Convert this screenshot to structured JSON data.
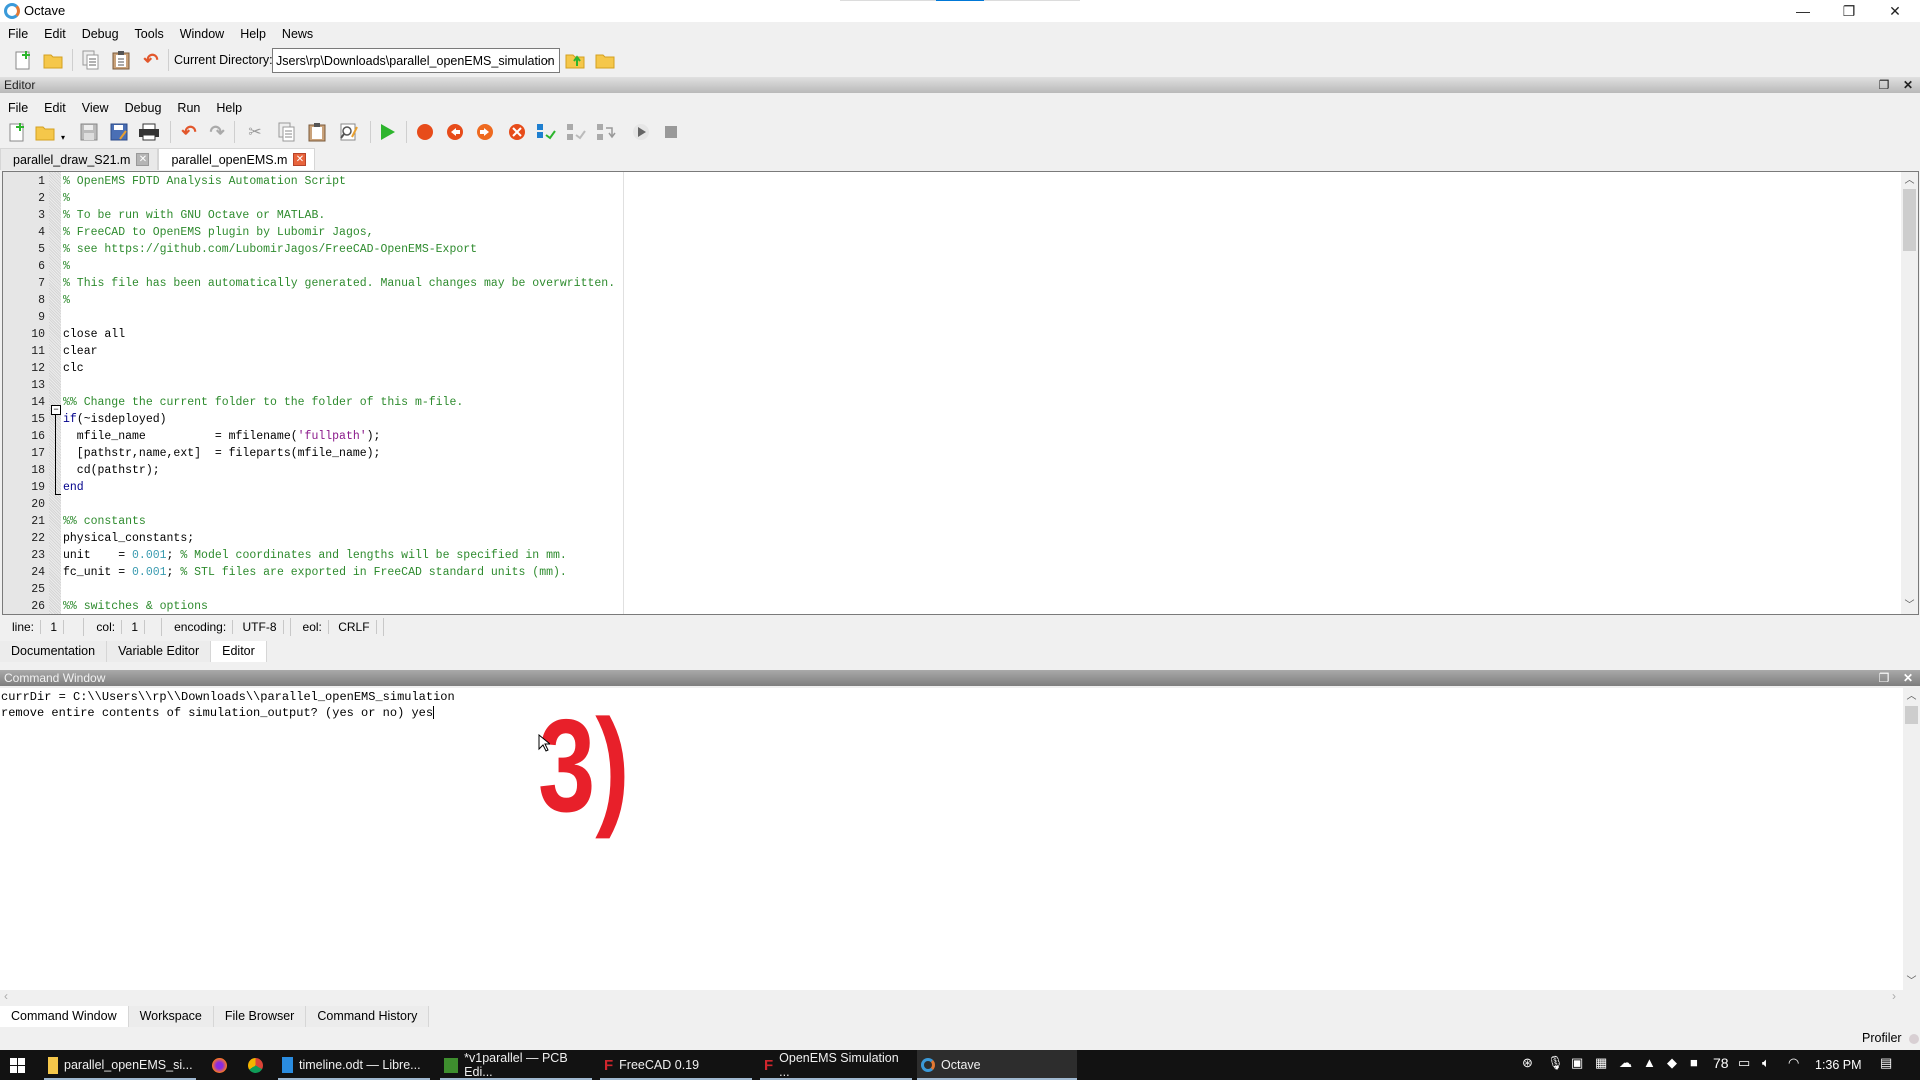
{
  "window": {
    "title": "Octave",
    "controls": {
      "minimize": "—",
      "restore": "❐",
      "close": "✕"
    }
  },
  "main_menu": [
    "File",
    "Edit",
    "Debug",
    "Tools",
    "Window",
    "Help",
    "News"
  ],
  "main_toolbar": {
    "icons": [
      "new-script-icon",
      "open-folder-icon",
      "copy-icon",
      "paste-icon",
      "undo-icon"
    ],
    "current_directory_label": "Current Directory:",
    "current_directory_value": "Jsers\\rp\\Downloads\\parallel_openEMS_simulation",
    "dir_icons": [
      "parent-directory-icon",
      "browse-folder-icon"
    ]
  },
  "editor": {
    "dock_title": "Editor",
    "menu": [
      "File",
      "Edit",
      "View",
      "Debug",
      "Run",
      "Help"
    ],
    "toolbar_icons": [
      "new-file-icon",
      "open-file-icon",
      "save-icon",
      "save-as-icon",
      "print-icon",
      "undo-icon",
      "redo-icon",
      "cut-icon",
      "copy-icon",
      "paste-icon",
      "find-replace-icon",
      "run-icon",
      "toggle-breakpoint-icon",
      "previous-breakpoint-icon",
      "next-breakpoint-icon",
      "remove-breakpoints-icon",
      "step-over-icon",
      "step-in-icon",
      "step-out-icon",
      "continue-icon",
      "quit-debug-icon"
    ],
    "tabs": [
      {
        "label": "parallel_draw_S21.m",
        "active": false
      },
      {
        "label": "parallel_openEMS.m",
        "active": true
      }
    ],
    "lines": [
      {
        "n": "1",
        "seg": [
          {
            "t": "% OpenEMS FDTD Analysis Automation Script",
            "c": "com"
          }
        ]
      },
      {
        "n": "2",
        "seg": [
          {
            "t": "%",
            "c": "com"
          }
        ]
      },
      {
        "n": "3",
        "seg": [
          {
            "t": "% To be run with GNU Octave or MATLAB.",
            "c": "com"
          }
        ]
      },
      {
        "n": "4",
        "seg": [
          {
            "t": "% FreeCAD to OpenEMS plugin by Lubomir Jagos,",
            "c": "com"
          }
        ]
      },
      {
        "n": "5",
        "seg": [
          {
            "t": "% see https://github.com/LubomirJagos/FreeCAD-OpenEMS-Export",
            "c": "com"
          }
        ]
      },
      {
        "n": "6",
        "seg": [
          {
            "t": "%",
            "c": "com"
          }
        ]
      },
      {
        "n": "7",
        "seg": [
          {
            "t": "% This file has been automatically generated. Manual changes may be overwritten.",
            "c": "com"
          }
        ]
      },
      {
        "n": "8",
        "seg": [
          {
            "t": "%",
            "c": "com"
          }
        ]
      },
      {
        "n": "9",
        "seg": []
      },
      {
        "n": "10",
        "seg": [
          {
            "t": "close all",
            "c": "plain"
          }
        ]
      },
      {
        "n": "11",
        "seg": [
          {
            "t": "clear",
            "c": "plain"
          }
        ]
      },
      {
        "n": "12",
        "seg": [
          {
            "t": "clc",
            "c": "plain"
          }
        ]
      },
      {
        "n": "13",
        "seg": []
      },
      {
        "n": "14",
        "seg": [
          {
            "t": "%% Change the current folder to the folder of this m-file.",
            "c": "com"
          }
        ]
      },
      {
        "n": "15",
        "seg": [
          {
            "t": "if",
            "c": "kw"
          },
          {
            "t": "(~isdeployed)",
            "c": "plain"
          }
        ]
      },
      {
        "n": "16",
        "seg": [
          {
            "t": "  mfile_name          = mfilename(",
            "c": "plain"
          },
          {
            "t": "'fullpath'",
            "c": "str"
          },
          {
            "t": ");",
            "c": "plain"
          }
        ]
      },
      {
        "n": "17",
        "seg": [
          {
            "t": "  [pathstr,name,ext]  = fileparts(mfile_name);",
            "c": "plain"
          }
        ]
      },
      {
        "n": "18",
        "seg": [
          {
            "t": "  cd(pathstr);",
            "c": "plain"
          }
        ]
      },
      {
        "n": "19",
        "seg": [
          {
            "t": "end",
            "c": "kw"
          }
        ]
      },
      {
        "n": "20",
        "seg": []
      },
      {
        "n": "21",
        "seg": [
          {
            "t": "%% constants",
            "c": "com"
          }
        ]
      },
      {
        "n": "22",
        "seg": [
          {
            "t": "physical_constants;",
            "c": "plain"
          }
        ]
      },
      {
        "n": "23",
        "seg": [
          {
            "t": "unit    = ",
            "c": "plain"
          },
          {
            "t": "0.001",
            "c": "num"
          },
          {
            "t": "; ",
            "c": "plain"
          },
          {
            "t": "% Model coordinates and lengths will be specified in mm.",
            "c": "com"
          }
        ]
      },
      {
        "n": "24",
        "seg": [
          {
            "t": "fc_unit = ",
            "c": "plain"
          },
          {
            "t": "0.001",
            "c": "num"
          },
          {
            "t": "; ",
            "c": "plain"
          },
          {
            "t": "% STL files are exported in FreeCAD standard units (mm).",
            "c": "com"
          }
        ]
      },
      {
        "n": "25",
        "seg": []
      },
      {
        "n": "26",
        "seg": [
          {
            "t": "%% switches & options",
            "c": "com"
          }
        ]
      }
    ],
    "status": {
      "line_label": "line:",
      "line": "1",
      "col_label": "col:",
      "col": "1",
      "encoding_label": "encoding:",
      "encoding": "UTF-8",
      "eol_label": "eol:",
      "eol": "CRLF"
    }
  },
  "doc_tabs": [
    {
      "label": "Documentation",
      "active": false
    },
    {
      "label": "Variable Editor",
      "active": false
    },
    {
      "label": "Editor",
      "active": true
    }
  ],
  "command_window": {
    "title": "Command Window",
    "output": [
      "currDir = C:\\\\Users\\\\rp\\\\Downloads\\\\parallel_openEMS_simulation",
      "remove entire contents of simulation_output? (yes or no) yes"
    ]
  },
  "overlay_annotation": "3)",
  "bottom_tabs": [
    {
      "label": "Command Window",
      "active": true
    },
    {
      "label": "Workspace",
      "active": false
    },
    {
      "label": "File Browser",
      "active": false
    },
    {
      "label": "Command History",
      "active": false
    }
  ],
  "profiler_label": "Profiler",
  "taskbar": {
    "items": [
      {
        "label": "parallel_openEMS_si...",
        "icon": "folder-icon"
      },
      {
        "label": "",
        "icon": "firefox-icon"
      },
      {
        "label": "",
        "icon": "chrome-icon"
      },
      {
        "label": "timeline.odt — Libre...",
        "icon": "libreoffice-writer-icon"
      },
      {
        "label": "*v1parallel — PCB Edi...",
        "icon": "kicad-pcb-icon"
      },
      {
        "label": "FreeCAD 0.19",
        "icon": "freecad-icon"
      },
      {
        "label": "OpenEMS Simulation ...",
        "icon": "freecad-icon"
      },
      {
        "label": "Octave",
        "icon": "octave-icon"
      }
    ],
    "tray": {
      "temperature": "78",
      "time": "1:36 PM"
    }
  }
}
